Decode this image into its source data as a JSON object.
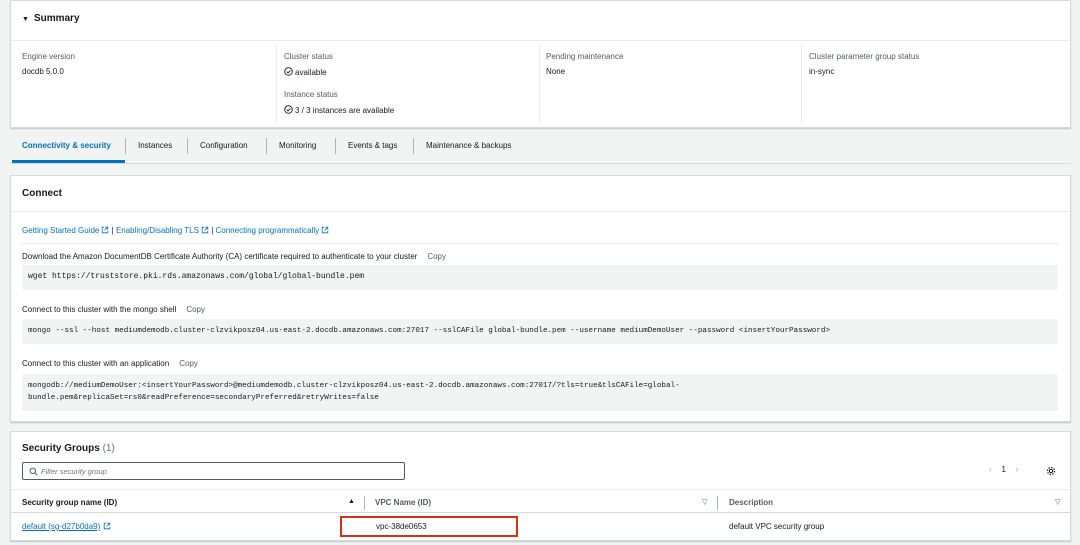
{
  "summary": {
    "title": "Summary",
    "engine_version_label": "Engine version",
    "engine_version_value": "docdb 5.0.0",
    "cluster_status_label": "Cluster status",
    "cluster_status_value": "available",
    "instance_status_label": "Instance status",
    "instance_status_value": "3 / 3 instances are available",
    "pending_maintenance_label": "Pending maintenance",
    "pending_maintenance_value": "None",
    "param_group_status_label": "Cluster parameter group status",
    "param_group_status_value": "in-sync"
  },
  "tabs": [
    {
      "label": "Connectivity & security",
      "active": true
    },
    {
      "label": "Instances"
    },
    {
      "label": "Configuration"
    },
    {
      "label": "Monitoring"
    },
    {
      "label": "Events & tags"
    },
    {
      "label": "Maintenance & backups"
    }
  ],
  "connect": {
    "title": "Connect",
    "links": [
      "Getting Started Guide",
      "Enabling/Disabling TLS",
      "Connecting programmatically"
    ],
    "separator": "|",
    "copy_label": "Copy",
    "ca_label": "Download the Amazon DocumentDB Certificate Authority (CA) certificate required to authenticate to your cluster",
    "ca_command": "wget https://truststore.pki.rds.amazonaws.com/global/global-bundle.pem",
    "shell_label": "Connect to this cluster with the mongo shell",
    "shell_command": "mongo --ssl --host mediumdemodb.cluster-clzvikposz04.us-east-2.docdb.amazonaws.com:27017 --sslCAFile global-bundle.pem --username mediumDemoUser --password <insertYourPassword>",
    "app_label": "Connect to this cluster with an application",
    "app_command_line1": "mongodb://mediumDemoUser:<insertYourPassword>@mediumdemodb.cluster-clzvikposz04.us-east-2.docdb.amazonaws.com:27017/?tls=true&tlsCAFile=global-",
    "app_command_line2": "bundle.pem&replicaSet=rs0&readPreference=secondaryPreferred&retryWrites=false"
  },
  "security_groups": {
    "title": "Security Groups",
    "count": "(1)",
    "filter_placeholder": "Filter security group",
    "page_number": "1",
    "columns": [
      "Security group name (ID)",
      "VPC Name (ID)",
      "Description"
    ],
    "rows": [
      {
        "name": "default (sg-d27b0da9)",
        "vpc": "vpc-38de0653",
        "description": "default VPC security group"
      }
    ]
  },
  "colors": {
    "link": "#0073bb",
    "highlight_box": "#d13212",
    "active_tab": "#0073bb"
  }
}
